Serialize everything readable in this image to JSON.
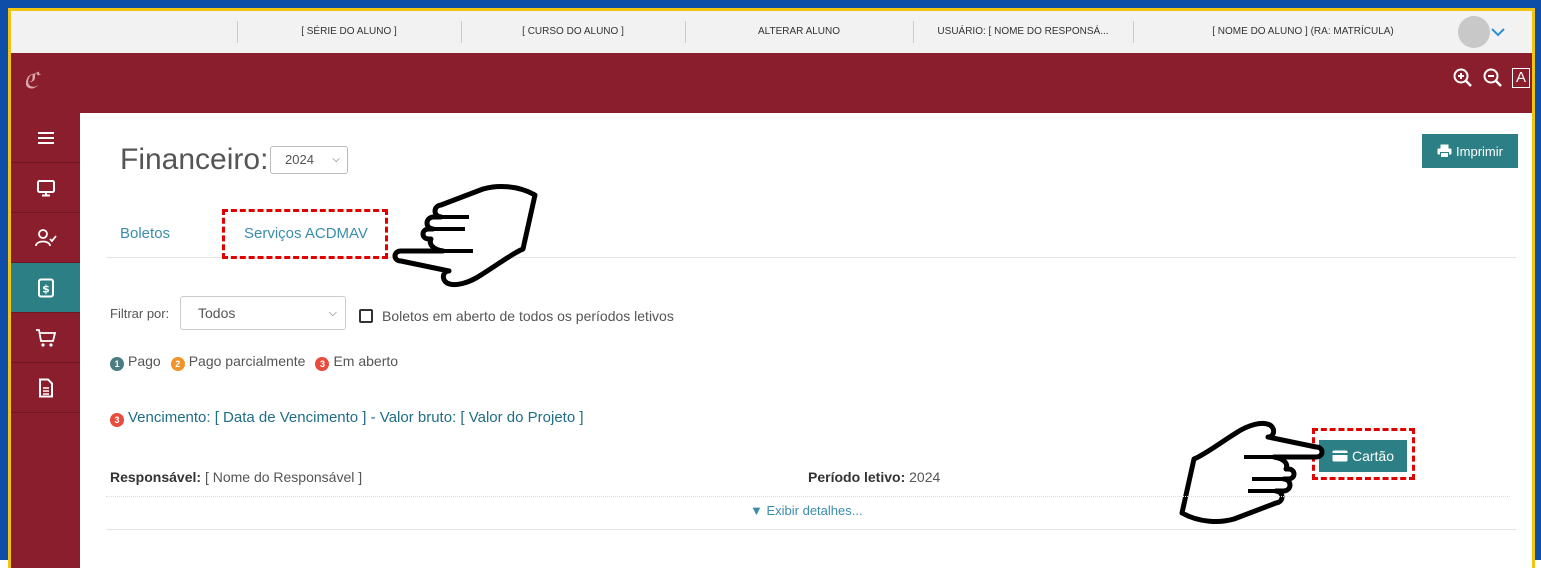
{
  "topbar": {
    "serie": "[ SÉRIE DO ALUNO ]",
    "curso": "[ CURSO DO ALUNO ]",
    "alterar": "ALTERAR ALUNO",
    "usuario": "USUÁRIO: [ NOME DO RESPONSÁ...",
    "aluno": "[ NOME DO ALUNO ] (RA: MATRÍCULA)"
  },
  "brand": {
    "logo": "ℭ",
    "font_label": "A"
  },
  "sidebar": {
    "items": [
      {
        "icon": "menu-icon"
      },
      {
        "icon": "monitor-icon"
      },
      {
        "icon": "user-check-icon"
      },
      {
        "icon": "finance-document-icon",
        "active": true
      },
      {
        "icon": "cart-icon"
      },
      {
        "icon": "document-icon"
      }
    ]
  },
  "page": {
    "title": "Financeiro:",
    "year": "2024",
    "print_label": "Imprimir",
    "tabs": [
      "Boletos",
      "Serviços ACDMAV"
    ],
    "filter_label": "Filtrar por:",
    "filter_value": "Todos",
    "checkbox_label": "Boletos em aberto de todos os períodos letivos",
    "legend": [
      {
        "num": "1",
        "label": "Pago",
        "color": "#4a7d82"
      },
      {
        "num": "2",
        "label": "Pago parcialmente",
        "color": "#f0932b"
      },
      {
        "num": "3",
        "label": "Em aberto",
        "color": "#e74c3c"
      }
    ],
    "due": {
      "num": "3",
      "text": "Vencimento: [ Data de Vencimento ] - Valor bruto: [ Valor do Projeto ]"
    },
    "card_label": "Cartão",
    "resp_label": "Responsável:",
    "resp_value": "[ Nome do Responsável ]",
    "period_label": "Período letivo:",
    "period_value": "2024",
    "details_label": "▼ Exibir detalhes..."
  },
  "colors": {
    "brand": "#8b1e2c",
    "accent": "#2c7f85",
    "frame": "#0f4ea8",
    "frame_border": "#f1c40f",
    "highlight": "#e00000"
  }
}
